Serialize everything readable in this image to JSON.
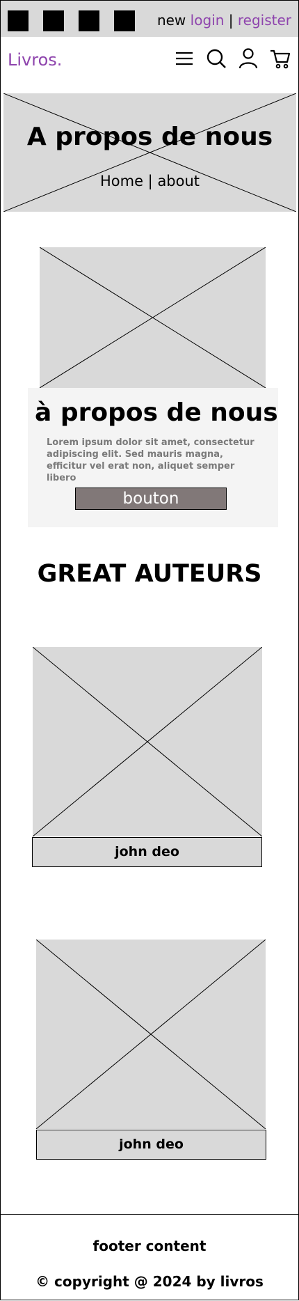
{
  "topbar": {
    "social_icons": [
      "social-icon-1",
      "social-icon-2",
      "social-icon-3",
      "social-icon-4"
    ],
    "new_label": "new",
    "login_label": "login",
    "separator": "|",
    "register_label": "register"
  },
  "nav": {
    "logo": "Livros.",
    "icons": [
      "menu-icon",
      "search-icon",
      "user-icon",
      "cart-icon"
    ]
  },
  "hero": {
    "title": "A propos de nous",
    "breadcrumb_home": "Home",
    "breadcrumb_separator": "|",
    "breadcrumb_current": "about"
  },
  "about": {
    "heading": "à propos de nous",
    "text": "Lorem ipsum dolor sit amet, consectetur adipiscing elit. Sed mauris magna, efficitur vel erat non, aliquet semper libero",
    "button_label": "bouton"
  },
  "authors": {
    "title": "GREAT AUTEURS",
    "items": [
      {
        "name": "john deo"
      },
      {
        "name": "john deo"
      }
    ]
  },
  "footer": {
    "content": "footer content",
    "copyright": "© copyright @ 2024 by livros"
  },
  "colors": {
    "accent": "#8e44ad",
    "placeholder": "#d9d9d9",
    "button": "#817878",
    "card": "#f4f4f4"
  }
}
